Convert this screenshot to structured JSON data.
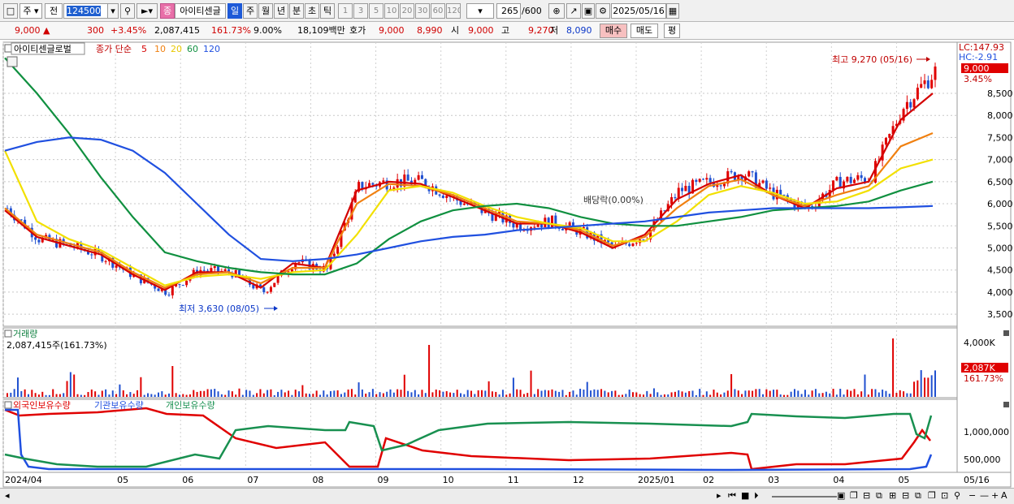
{
  "toolbar": {
    "market": "주",
    "prev": "전",
    "code": "124500",
    "badge": "종",
    "name": "아이티센글",
    "periods": [
      "일",
      "주",
      "월",
      "년",
      "분",
      "초",
      "틱"
    ],
    "active_period": "일",
    "intervals": [
      "1",
      "3",
      "5",
      "10",
      "20",
      "30",
      "60",
      "120"
    ],
    "count": "265",
    "count_total": "/600",
    "date": "2025/05/16"
  },
  "quote": {
    "price": "9,000",
    "up_mark": "▲",
    "change": "300",
    "change_pct": "+3.45%",
    "volume": "2,087,415",
    "volume_ratio": "161.73%",
    "rate": "9.00%",
    "amount": "18,109백만",
    "ask_label": "호가",
    "ask1": "9,000",
    "ask2": "8,990",
    "open_label": "시",
    "open": "9,000",
    "high_label": "고",
    "high": "9,270",
    "low_label": "저",
    "low": "8,090",
    "buy": "매수",
    "sell": "매도",
    "eval": "평"
  },
  "price_panel": {
    "header_name": "아이티센글로벌",
    "ma_label": "종가 단순",
    "ma_periods": [
      "5",
      "10",
      "20",
      "60",
      "120"
    ],
    "ma_colors": [
      "#d40000",
      "#f08010",
      "#f2e000",
      "#109040",
      "#2050e0"
    ],
    "lc": "LC:147.93",
    "hc": "HC:-2.91",
    "current_tag": "9,000",
    "current_pct": "3.45%",
    "high_note": "최고 9,270 (05/16)",
    "low_note": "최저 3,630 (08/05)",
    "div_note": "배당락(0.00%)"
  },
  "volume_panel": {
    "title": "거래량",
    "info": "2,087,415주(161.73%)",
    "tick": "4,000K",
    "current_tag": "2,087K",
    "current_pct": "161.73%"
  },
  "holding_panel": {
    "labels": [
      "외국인보유수량",
      "기관보유수량",
      "개인보유수량"
    ],
    "colors": [
      "#e00000",
      "#2050e0",
      "#189050"
    ],
    "ticks": [
      "1,000,000",
      "500,000"
    ]
  },
  "xaxis": {
    "labels": [
      "2024/04",
      "05",
      "06",
      "07",
      "08",
      "09",
      "10",
      "11",
      "12",
      "2025/01",
      "02",
      "03",
      "04",
      "05"
    ],
    "right": "05/16"
  },
  "chart_data": {
    "type": "line",
    "title": "아이티센글로벌",
    "x_categories": [
      "2024/04",
      "05",
      "06",
      "07",
      "08",
      "09",
      "10",
      "11",
      "12",
      "2025/01",
      "02",
      "03",
      "04",
      "05"
    ],
    "y_ticks": [
      3500,
      4000,
      4500,
      5000,
      5500,
      6000,
      6500,
      7000,
      7500,
      8000,
      8500
    ],
    "ylim": [
      3300,
      9400
    ],
    "series": [
      {
        "name": "종가",
        "values": [
          5900,
          5200,
          5050,
          4800,
          4350,
          4000,
          4500,
          4450,
          4000,
          4700,
          4500,
          6400,
          6500,
          6500,
          6100,
          5800,
          5500,
          5600,
          5350,
          5000,
          5300,
          6300,
          6500,
          6700,
          6200,
          5900,
          6500,
          6600,
          8200,
          9000
        ]
      },
      {
        "name": "5",
        "values": [
          5850,
          5250,
          5050,
          4850,
          4400,
          4050,
          4450,
          4450,
          4100,
          4650,
          4550,
          6300,
          6500,
          6450,
          6150,
          5850,
          5550,
          5550,
          5350,
          5000,
          5300,
          6100,
          6450,
          6650,
          6200,
          5900,
          6350,
          6500,
          7900,
          8500
        ]
      },
      {
        "name": "10",
        "values": [
          5900,
          5300,
          5100,
          4900,
          4450,
          4100,
          4400,
          4450,
          4200,
          4550,
          4550,
          6000,
          6450,
          6400,
          6200,
          5900,
          5600,
          5550,
          5400,
          5050,
          5250,
          5900,
          6400,
          6550,
          6200,
          5950,
          6200,
          6400,
          7300,
          7600
        ]
      },
      {
        "name": "20",
        "values": [
          7200,
          5600,
          5200,
          4950,
          4550,
          4150,
          4350,
          4400,
          4300,
          4450,
          4500,
          5300,
          6300,
          6400,
          6250,
          5950,
          5700,
          5550,
          5450,
          5150,
          5150,
          5600,
          6200,
          6400,
          6250,
          6000,
          6050,
          6300,
          6800,
          7000
        ]
      },
      {
        "name": "60",
        "values": [
          9300,
          8500,
          7600,
          6600,
          5700,
          4900,
          4700,
          4550,
          4450,
          4400,
          4400,
          4650,
          5200,
          5600,
          5850,
          5950,
          6000,
          5900,
          5700,
          5550,
          5500,
          5500,
          5600,
          5700,
          5850,
          5900,
          5950,
          6050,
          6300,
          6500
        ]
      },
      {
        "name": "120",
        "values": [
          7200,
          7400,
          7500,
          7450,
          7200,
          6700,
          6000,
          5300,
          4750,
          4700,
          4750,
          4850,
          5000,
          5150,
          5250,
          5300,
          5400,
          5450,
          5500,
          5550,
          5600,
          5700,
          5800,
          5850,
          5900,
          5900,
          5900,
          5900,
          5920,
          5950
        ]
      }
    ],
    "volume_ticks": [
      "4,000K"
    ],
    "holdings_ticks": [
      1000000,
      500000
    ]
  }
}
